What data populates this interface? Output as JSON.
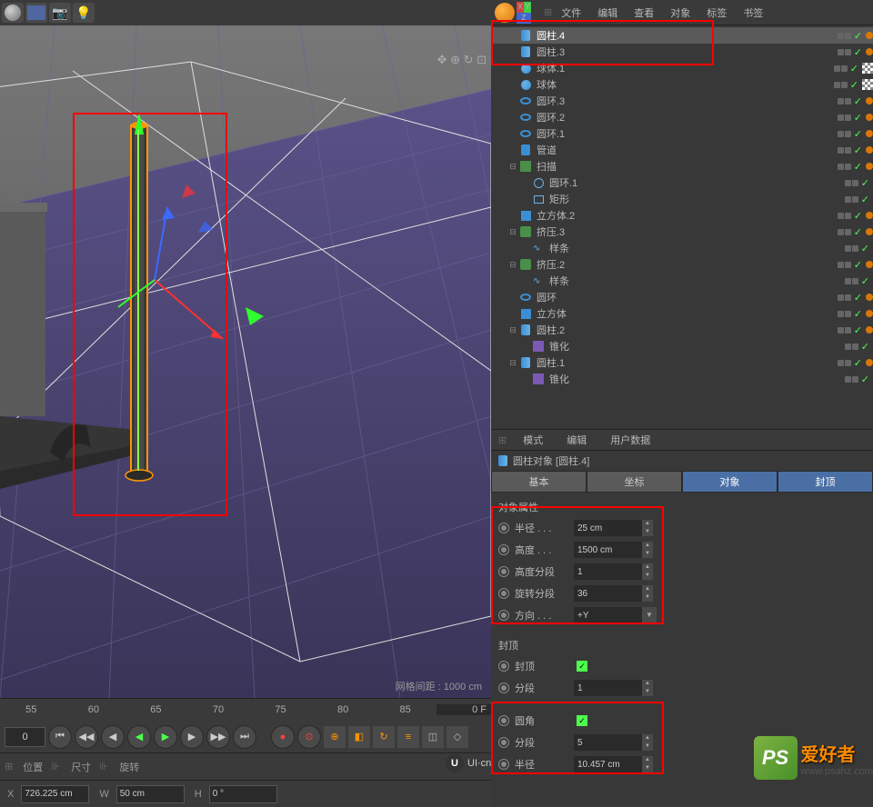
{
  "toolbar": {
    "grid_label": "网格间距 : 1000 cm"
  },
  "nav": {
    "icons": "✥ ⊕ ↻ ⊡"
  },
  "obj_menu": {
    "file": "文件",
    "edit": "编辑",
    "view": "查看",
    "objects": "对象",
    "tags": "标签",
    "bookmarks": "书签"
  },
  "tree": [
    {
      "name": "圆柱.4",
      "icon": "cyl",
      "indent": 1,
      "expand": "",
      "sel": true,
      "tags": [
        "dot"
      ]
    },
    {
      "name": "圆柱.3",
      "icon": "cyl",
      "indent": 1,
      "expand": "",
      "tags": [
        "dot"
      ]
    },
    {
      "name": "球体.1",
      "icon": "sph",
      "indent": 1,
      "expand": "",
      "tags": [
        "check"
      ]
    },
    {
      "name": "球体",
      "icon": "sph",
      "indent": 1,
      "expand": "",
      "tags": [
        "check"
      ]
    },
    {
      "name": "圆环.3",
      "icon": "tor",
      "indent": 1,
      "expand": "",
      "tags": [
        "dot"
      ]
    },
    {
      "name": "圆环.2",
      "icon": "tor",
      "indent": 1,
      "expand": "",
      "tags": [
        "dot"
      ]
    },
    {
      "name": "圆环.1",
      "icon": "tor",
      "indent": 1,
      "expand": "",
      "tags": [
        "dot"
      ]
    },
    {
      "name": "管道",
      "icon": "tube",
      "indent": 1,
      "expand": "",
      "tags": [
        "dot"
      ]
    },
    {
      "name": "扫描",
      "icon": "sweep",
      "indent": 1,
      "expand": "⊟",
      "tags": [
        "dot"
      ]
    },
    {
      "name": "圆环.1",
      "icon": "circle",
      "indent": 2,
      "expand": ""
    },
    {
      "name": "矩形",
      "icon": "rect",
      "indent": 2,
      "expand": ""
    },
    {
      "name": "立方体.2",
      "icon": "cube",
      "indent": 1,
      "expand": "",
      "tags": [
        "dot"
      ]
    },
    {
      "name": "挤压.3",
      "icon": "extr",
      "indent": 1,
      "expand": "⊟",
      "tags": [
        "dot"
      ]
    },
    {
      "name": "样条",
      "icon": "spline",
      "indent": 2,
      "expand": ""
    },
    {
      "name": "挤压.2",
      "icon": "extr",
      "indent": 1,
      "expand": "⊟",
      "tags": [
        "dot"
      ]
    },
    {
      "name": "样条",
      "icon": "spline",
      "indent": 2,
      "expand": ""
    },
    {
      "name": "圆环",
      "icon": "tor",
      "indent": 1,
      "expand": "",
      "tags": [
        "dot"
      ]
    },
    {
      "name": "立方体",
      "icon": "cube",
      "indent": 1,
      "expand": "",
      "tags": [
        "dot"
      ]
    },
    {
      "name": "圆柱.2",
      "icon": "cyl",
      "indent": 1,
      "expand": "⊟",
      "tags": [
        "dot"
      ]
    },
    {
      "name": "锥化",
      "icon": "taper",
      "indent": 2,
      "expand": ""
    },
    {
      "name": "圆柱.1",
      "icon": "cyl",
      "indent": 1,
      "expand": "⊟",
      "tags": [
        "dot"
      ]
    },
    {
      "name": "锥化",
      "icon": "taper",
      "indent": 2,
      "expand": ""
    }
  ],
  "attr_header": {
    "mode": "模式",
    "edit": "编辑",
    "userdata": "用户数据"
  },
  "attr_title": "圆柱对象 [圆柱.4]",
  "tabs": {
    "basic": "基本",
    "coord": "坐标",
    "object": "对象",
    "caps": "封顶"
  },
  "obj_attrs": {
    "title": "对象属性",
    "radius_label": "半径 . . .",
    "radius": "25 cm",
    "height_label": "高度 . . .",
    "height": "1500 cm",
    "hseg_label": "高度分段",
    "hseg": "1",
    "rseg_label": "旋转分段",
    "rseg": "36",
    "dir_label": "方向 . . .",
    "dir": "+Y"
  },
  "caps": {
    "title": "封顶",
    "cap_label": "封顶",
    "seg_label": "分段",
    "seg": "1",
    "fillet_label": "圆角",
    "fseg_label": "分段",
    "fseg": "5",
    "fradius_label": "半径",
    "fradius": "10.457 cm"
  },
  "timeline": {
    "t55": "55",
    "t60": "60",
    "t65": "65",
    "t70": "70",
    "t75": "75",
    "t80": "80",
    "t85": "85",
    "end": "0 F",
    "frame": "0"
  },
  "bottom": {
    "pos_label": "位置",
    "size_label": "尺寸",
    "rot_label": "旋转",
    "x_label": "X",
    "w_label": "W",
    "h_label": "H",
    "x": "726.225 cm",
    "w": "50 cm",
    "h": "0 °"
  },
  "watermark": {
    "ui": "UI·cn",
    "ps": "PS",
    "ps_zh": "爱好者",
    "ps_url": "www.psahz.com"
  }
}
